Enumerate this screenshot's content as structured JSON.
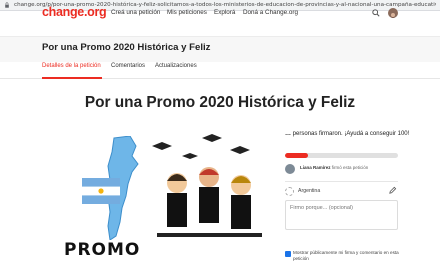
{
  "browser": {
    "url": "change.org/p/por-una-promo-2020-histórica-y-feliz-solicitamos-a-todos-los-ministerios-de-educacion-de-provincias-y-al-nacional-una-campaña-educativa-nacional-y-virt..."
  },
  "header": {
    "logo": "change.org",
    "nav": [
      "Creá una petición",
      "Mis peticiones",
      "Explorá",
      "Doná a Change.org"
    ]
  },
  "petition": {
    "title_bar": "Por una Promo 2020 Histórica y Feliz",
    "tabs": [
      "Detalles de la petición",
      "Comentarios",
      "Actualizaciones"
    ],
    "active_tab": 0,
    "main_title": "Por una Promo 2020 Histórica y Feliz",
    "image_text": "PROMO"
  },
  "sidebar": {
    "signers_count": "…",
    "signers_text": " personas firmaron. ¡Ayudá a conseguir 100!",
    "progress": 0.2,
    "recent_name": "Liana Ramírez",
    "recent_action": " firmó esta petición",
    "signer_location": "Argentina",
    "comment_placeholder": "Firmo porque... (opcional)",
    "checkbox_label": "Mostrar públicamente mi firma y comentario en esta petición"
  },
  "colors": {
    "brand": "#ec2c22",
    "progress": "#ec2c22",
    "checkbox": "#1a73e8"
  }
}
